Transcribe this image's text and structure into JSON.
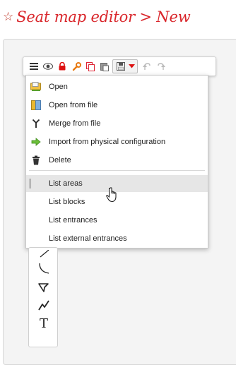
{
  "header": {
    "star_icon": "star-outline-icon",
    "title": "Seat map editor > New",
    "title_color": "#d9262b"
  },
  "toolbar": {
    "buttons": [
      {
        "name": "menu",
        "icon": "hamburger-icon"
      },
      {
        "name": "view",
        "icon": "eye-icon"
      },
      {
        "name": "lock",
        "icon": "lock-icon"
      },
      {
        "name": "tools",
        "icon": "wrench-icon"
      },
      {
        "name": "copy",
        "icon": "copy-icon"
      },
      {
        "name": "paste",
        "icon": "paste-icon"
      },
      {
        "name": "save",
        "icon": "floppy-icon"
      },
      {
        "name": "save-options",
        "icon": "caret-down-icon"
      },
      {
        "name": "undo",
        "icon": "undo-icon"
      },
      {
        "name": "redo",
        "icon": "redo-icon"
      }
    ]
  },
  "menu": {
    "items": [
      {
        "label": "Open",
        "icon": "open-folder-icon"
      },
      {
        "label": "Open from file",
        "icon": "file-open-icon"
      },
      {
        "label": "Merge from file",
        "icon": "merge-icon"
      },
      {
        "label": "Import from physical configuration",
        "icon": "import-icon"
      },
      {
        "label": "Delete",
        "icon": "trash-icon"
      },
      {
        "label": "List areas",
        "hovered": true
      },
      {
        "label": "List blocks"
      },
      {
        "label": "List entrances"
      },
      {
        "label": "List external entrances"
      }
    ]
  },
  "draw_tools": {
    "items": [
      {
        "icon": "line-tool-icon"
      },
      {
        "icon": "arc-tool-icon"
      },
      {
        "icon": "polygon-tool-icon"
      },
      {
        "icon": "polyline-tool-icon"
      },
      {
        "icon": "text-tool-icon",
        "glyph": "T"
      }
    ]
  }
}
